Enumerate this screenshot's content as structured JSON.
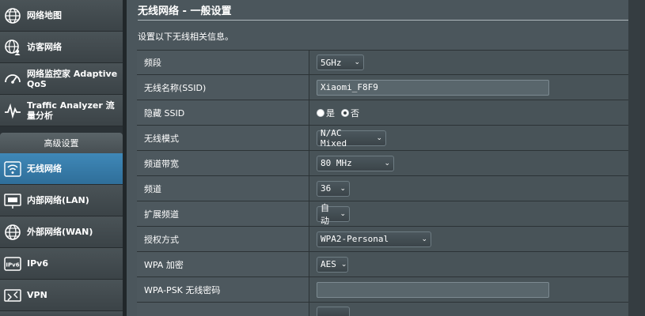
{
  "sidebar": {
    "top_items": [
      {
        "label": "网络地图",
        "icon": "globe-icon"
      },
      {
        "label": "访客网络",
        "icon": "globe-people-icon"
      },
      {
        "label": "网络监控家 Adaptive QoS",
        "icon": "speedometer-icon"
      },
      {
        "label": "Traffic Analyzer 流量分析",
        "icon": "pulse-icon"
      }
    ],
    "advanced_header": "高级设置",
    "advanced_items": [
      {
        "label": "无线网络",
        "icon": "wifi-icon",
        "active": true
      },
      {
        "label": "内部网络(LAN)",
        "icon": "lan-icon"
      },
      {
        "label": "外部网络(WAN)",
        "icon": "wan-globe-icon"
      },
      {
        "label": "IPv6",
        "icon": "ipv6-icon"
      },
      {
        "label": "VPN",
        "icon": "vpn-icon"
      }
    ]
  },
  "main": {
    "title": "无线网络 - 一般设置",
    "description": "设置以下无线相关信息。",
    "rows": {
      "band": {
        "label": "频段",
        "value": "5GHz"
      },
      "ssid": {
        "label": "无线名称(SSID)",
        "value": "Xiaomi_F8F9"
      },
      "hide_ssid": {
        "label": "隐藏 SSID",
        "yes": "是",
        "no": "否",
        "selected": "否"
      },
      "wireless_mode": {
        "label": "无线模式",
        "value": "N/AC Mixed"
      },
      "channel_bandwidth": {
        "label": "频道带宽",
        "value": "80 MHz"
      },
      "channel": {
        "label": "频道",
        "value": "36"
      },
      "extension_channel": {
        "label": "扩展频道",
        "value": "自动"
      },
      "auth_method": {
        "label": "授权方式",
        "value": "WPA2-Personal"
      },
      "wpa_encryption": {
        "label": "WPA 加密",
        "value": "AES"
      },
      "wpa_psk_key": {
        "label": "WPA-PSK 无线密码",
        "value": ""
      }
    }
  },
  "colors": {
    "sidebar_active": "#3f88b8",
    "panel_bg": "#4b565c",
    "page_bg": "#21272a"
  }
}
